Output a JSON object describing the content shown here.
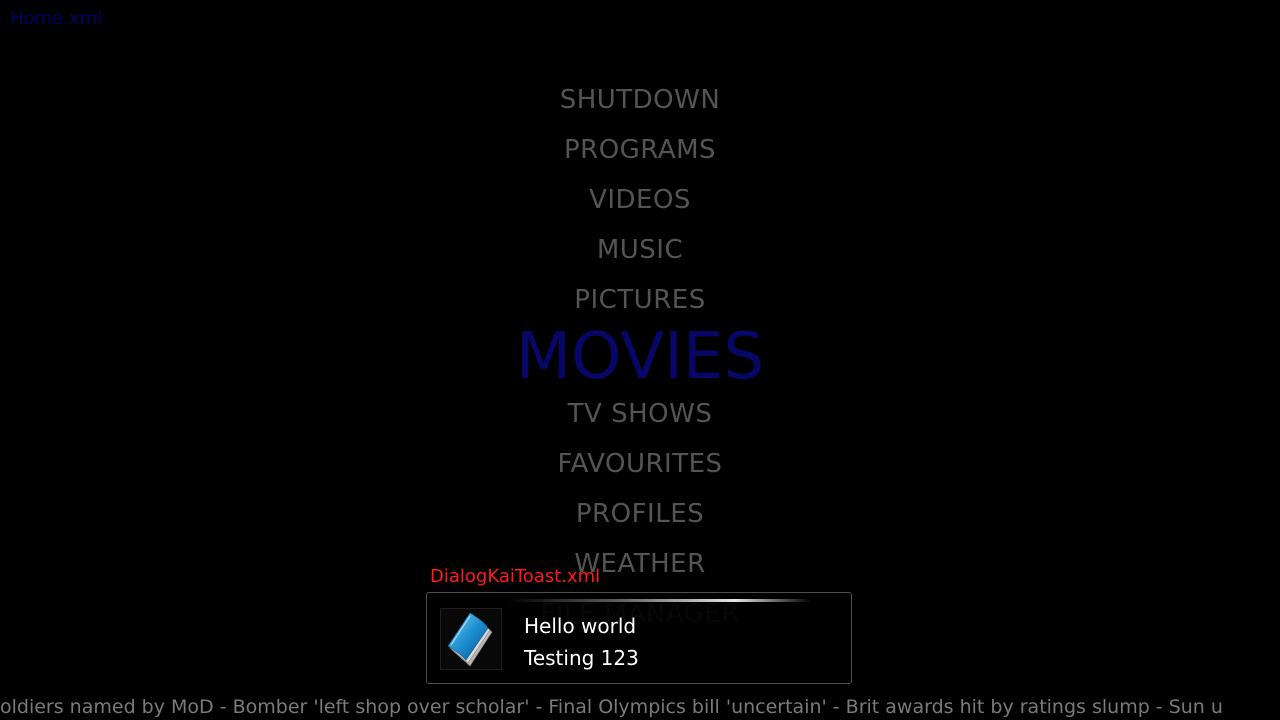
{
  "window": {
    "label": "Home.xml"
  },
  "main_menu": {
    "items": [
      {
        "label": "SHUTDOWN"
      },
      {
        "label": "PROGRAMS"
      },
      {
        "label": "VIDEOS"
      },
      {
        "label": "MUSIC"
      },
      {
        "label": "PICTURES"
      },
      {
        "label": "MOVIES",
        "selected": true
      },
      {
        "label": "TV SHOWS"
      },
      {
        "label": "FAVOURITES"
      },
      {
        "label": "PROFILES"
      },
      {
        "label": "WEATHER"
      },
      {
        "label": "FILE MANAGER"
      }
    ]
  },
  "toast": {
    "window_label": "DialogKaiToast.xml",
    "icon": "document-icon",
    "heading": "Hello world",
    "message": "Testing 123"
  },
  "ticker": {
    "text": "oldiers named by MoD - Bomber 'left shop over scholar' - Final Olympics bill 'uncertain' - Brit awards hit by ratings slump - Sun u"
  },
  "colors": {
    "background": "#000000",
    "menu_item": "#545454",
    "menu_selected": "#070769",
    "window_label": "#000066",
    "toast_label": "#ff1a1a",
    "ticker": "#7a7a7a"
  }
}
